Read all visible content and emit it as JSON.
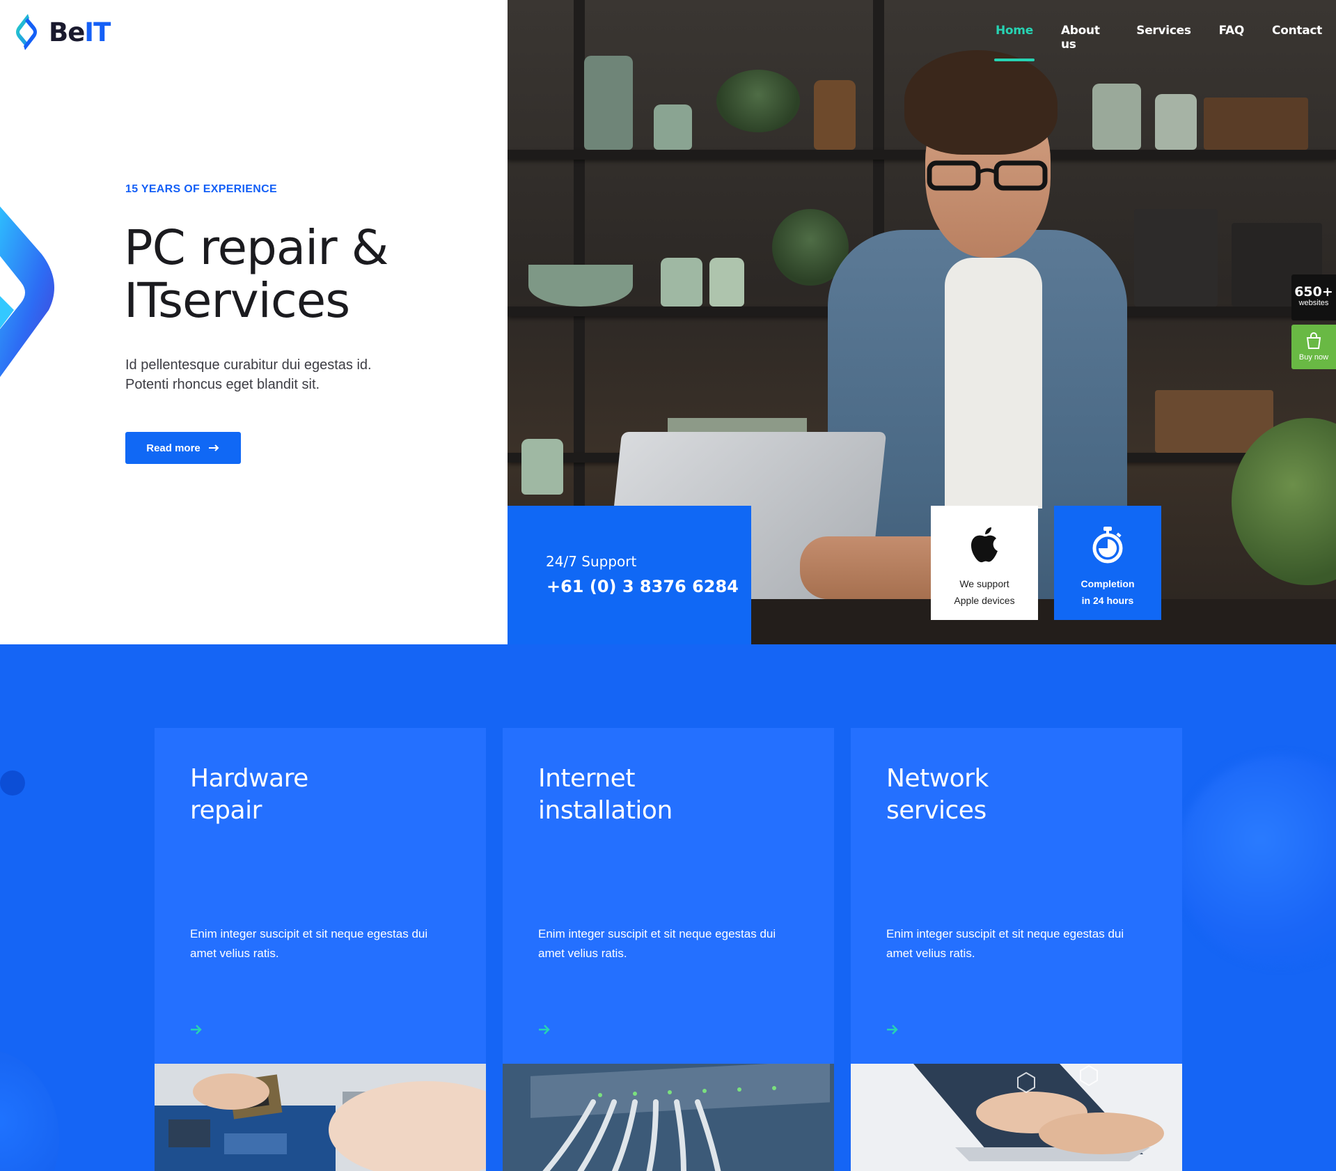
{
  "logo": {
    "text_prefix": "Be",
    "text_suffix": "IT"
  },
  "nav": {
    "items": [
      {
        "label": "Home",
        "active": true
      },
      {
        "label": "About us",
        "active": false
      },
      {
        "label": "Services",
        "active": false
      },
      {
        "label": "FAQ",
        "active": false
      },
      {
        "label": "Contact",
        "active": false
      }
    ]
  },
  "hero": {
    "eyebrow": "15 YEARS OF EXPERIENCE",
    "title_line1": "PC repair &",
    "title_line2": "ITservices",
    "description": "Id pellentesque curabitur dui egestas id. Potenti rhoncus eget blandit sit.",
    "button_label": "Read more"
  },
  "support": {
    "label": "24/7 Support",
    "phone": "+61 (0) 3 8376 6284"
  },
  "features": [
    {
      "line1": "We support",
      "line2": "Apple devices",
      "icon": "apple-icon"
    },
    {
      "line1": "Completion",
      "line2": "in 24 hours",
      "icon": "stopwatch-icon"
    }
  ],
  "side": {
    "sites_count": "650+",
    "sites_label": "websites",
    "buy_label": "Buy now"
  },
  "services": [
    {
      "title_line1": "Hardware",
      "title_line2": "repair",
      "description": "Enim integer suscipit et sit neque egestas dui amet velius ratis."
    },
    {
      "title_line1": "Internet",
      "title_line2": "installation",
      "description": "Enim integer suscipit et sit neque egestas dui amet velius ratis."
    },
    {
      "title_line1": "Network",
      "title_line2": "services",
      "description": "Enim integer suscipit et sit neque egestas dui amet velius ratis."
    }
  ],
  "colors": {
    "brand_blue": "#1068f5",
    "accent_teal": "#27d3b3",
    "section_blue": "#1565f5",
    "card_blue": "#2470ff",
    "buy_green": "#69b944"
  }
}
